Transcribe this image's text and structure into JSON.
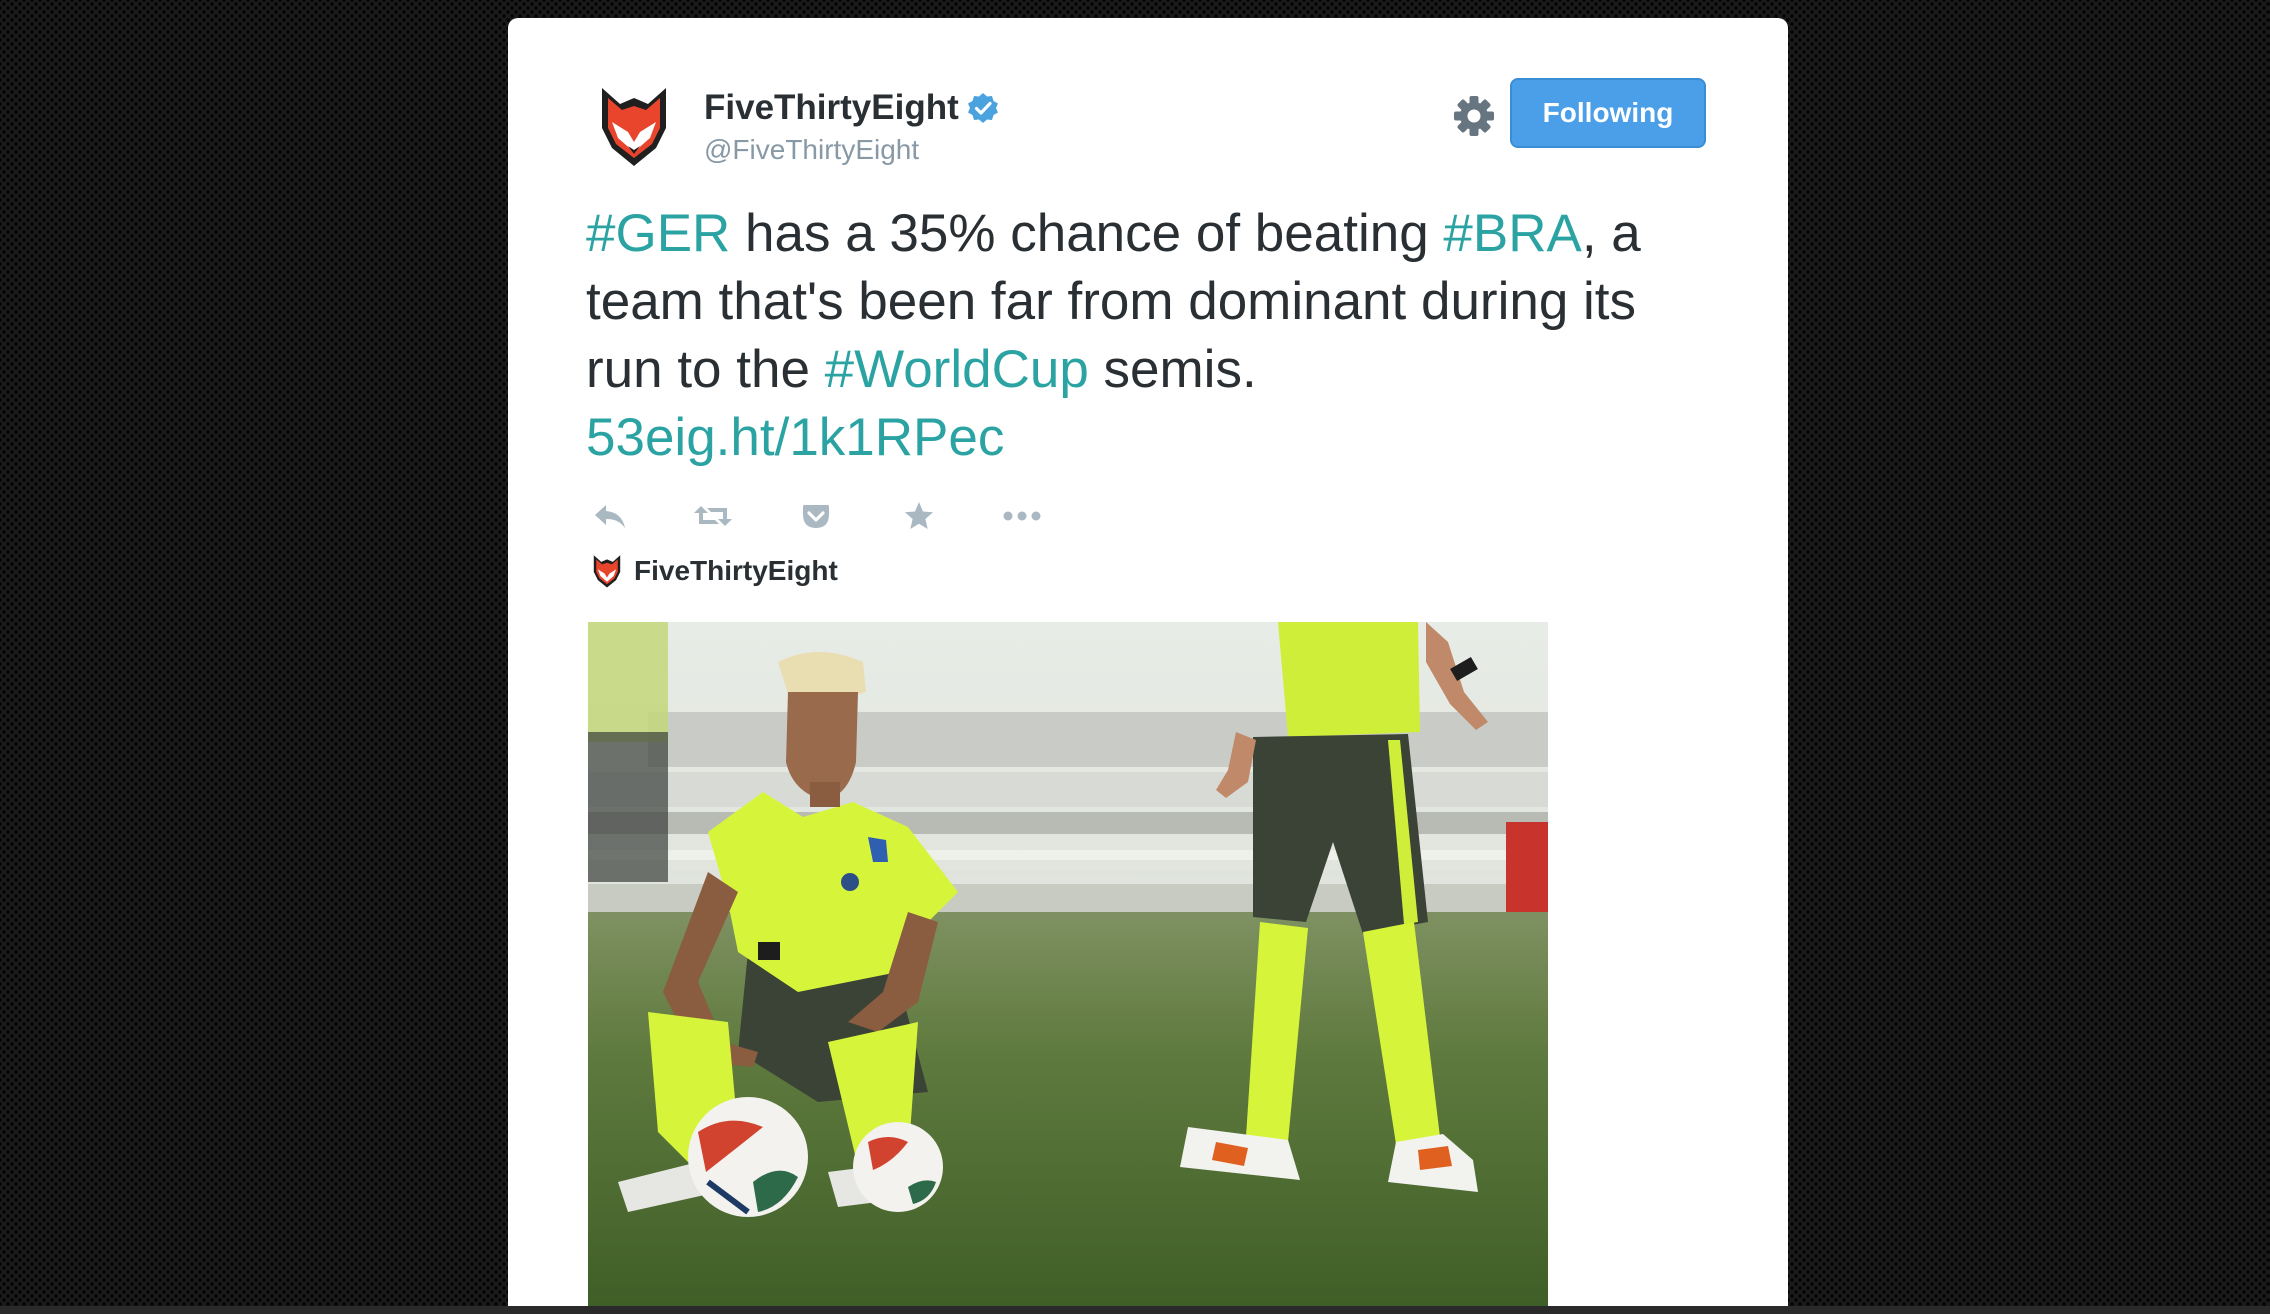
{
  "tweet": {
    "author_name": "FiveThirtyEight",
    "author_handle": "@FiveThirtyEight",
    "follow_label": "Following",
    "text": {
      "hashtag_ger": "#GER",
      "part1": " has a 35% chance of beating ",
      "hashtag_bra": "#BRA",
      "part2": ", a team that's been far from dominant during its run to the ",
      "hashtag_worldcup": "#WorldCup",
      "part3": " semis.",
      "link": "53eig.ht/1k1RPec"
    },
    "card_source": "FiveThirtyEight"
  },
  "icons": {
    "avatar": "fox-logo-icon",
    "verified": "verified-badge-icon",
    "settings": "gear-icon",
    "reply": "reply-icon",
    "retweet": "retweet-icon",
    "pocket": "pocket-icon",
    "favorite": "star-icon",
    "more": "more-icon"
  },
  "colors": {
    "link": "#2ba3a3",
    "follow_button": "#4a9fe8",
    "fox_orange": "#e8452c",
    "text": "#292f33",
    "muted": "#8899a6"
  }
}
